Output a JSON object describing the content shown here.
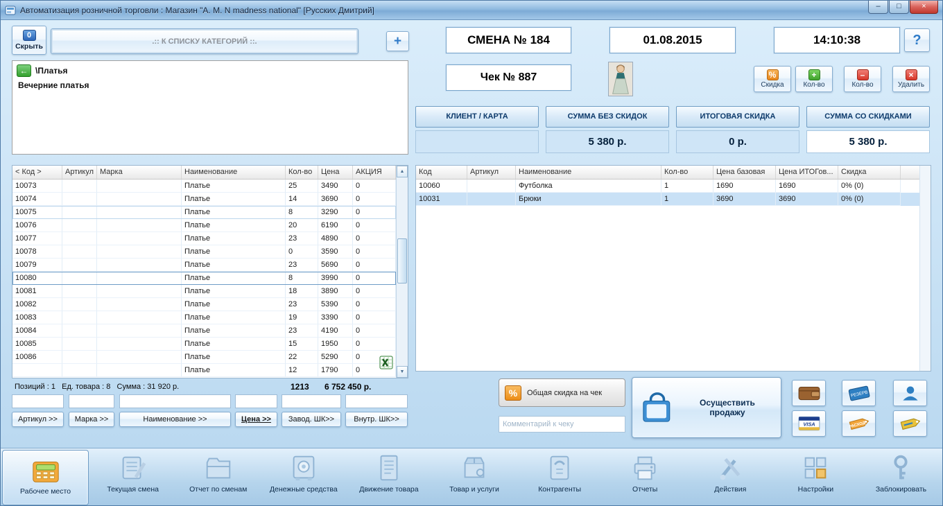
{
  "window": {
    "title": "Автоматизация розничной торговли : Магазин \"A. M. N madness national\" [Русских Дмитрий]",
    "controls": {
      "minimize": "–",
      "maximize": "□",
      "close": "×"
    }
  },
  "glyphs": {
    "plus": "+",
    "question": "?",
    "back": "←",
    "scroll_up": "▲",
    "scroll_down": "▼",
    "percent": "%",
    "qty_plus": "+",
    "qty_minus": "–",
    "delete": "×"
  },
  "top": {
    "hide_button": {
      "badge": "0",
      "label": "Скрыть"
    },
    "categories_button": ".:: К СПИСКУ КАТЕГОРИЙ ::.",
    "shift": "СМЕНА № 184",
    "date": "01.08.2015",
    "time": "14:10:38",
    "receipt": "Чек № 887"
  },
  "item_actions": {
    "discount": "Скидка",
    "qty_up": "Кол-во",
    "qty_down": "Кол-во",
    "delete": "Удалить"
  },
  "summary": {
    "cells": [
      {
        "header": "КЛИЕНТ / КАРТА",
        "value": ""
      },
      {
        "header": "СУММА БЕЗ СКИДОК",
        "value": "5 380 р."
      },
      {
        "header": "ИТОГОВАЯ СКИДКА",
        "value": "0 р."
      },
      {
        "header": "СУММА СО СКИДКАМИ",
        "value": "5 380 р."
      }
    ]
  },
  "catalog": {
    "path": "\\Платья",
    "category": "Вечерние платья",
    "columns": [
      "< Код >",
      "Артикул",
      "Марка",
      "Наименование",
      "Кол-во",
      "Цена",
      "АКЦИЯ"
    ],
    "rows": [
      [
        "10073",
        "",
        "",
        "Платье",
        "25",
        "3490",
        "0"
      ],
      [
        "10074",
        "",
        "",
        "Платье",
        "14",
        "3690",
        "0"
      ],
      [
        "10075",
        "",
        "",
        "Платье",
        "8",
        "3290",
        "0"
      ],
      [
        "10076",
        "",
        "",
        "Платье",
        "20",
        "6190",
        "0"
      ],
      [
        "10077",
        "",
        "",
        "Платье",
        "23",
        "4890",
        "0"
      ],
      [
        "10078",
        "",
        "",
        "Платье",
        "0",
        "3590",
        "0"
      ],
      [
        "10079",
        "",
        "",
        "Платье",
        "23",
        "5690",
        "0"
      ],
      [
        "10080",
        "",
        "",
        "Платье",
        "8",
        "3990",
        "0"
      ],
      [
        "10081",
        "",
        "",
        "Платье",
        "18",
        "3890",
        "0"
      ],
      [
        "10082",
        "",
        "",
        "Платье",
        "23",
        "5390",
        "0"
      ],
      [
        "10083",
        "",
        "",
        "Платье",
        "19",
        "3390",
        "0"
      ],
      [
        "10084",
        "",
        "",
        "Платье",
        "23",
        "4190",
        "0"
      ],
      [
        "10085",
        "",
        "",
        "Платье",
        "15",
        "1950",
        "0"
      ],
      [
        "10086",
        "",
        "",
        "Платье",
        "22",
        "5290",
        "0"
      ],
      [
        "",
        "",
        "",
        "Платье",
        "12",
        "1790",
        "0"
      ]
    ],
    "selected_row": 7,
    "hover_row": 2,
    "status": "Позиций : 1   Ед. товара : 8   Сумма : 31 920 р.",
    "total_qty": "1213",
    "total_sum": "6 752 450 р."
  },
  "filters": {
    "inputs": [
      "",
      "",
      "",
      "",
      "",
      ""
    ],
    "buttons": [
      "Артикул >>",
      "Марка >>",
      "Наименование >>",
      "Цена >>",
      "Завод. ШК>>",
      "Внутр. ШК>>"
    ],
    "active_button": 3
  },
  "receipt_table": {
    "columns": [
      "Код",
      "Артикул",
      "Наименование",
      "Кол-во",
      "Цена базовая",
      "Цена ИТОГов...",
      "Скидка"
    ],
    "rows": [
      [
        "10060",
        "",
        "Футболка",
        "1",
        "1690",
        "1690",
        "0% (0)"
      ],
      [
        "10031",
        "",
        "Брюки",
        "1",
        "3690",
        "3690",
        "0% (0)"
      ]
    ],
    "selected_row": 1
  },
  "sale": {
    "total_discount_button": "Общая скидка на чек",
    "comment_placeholder": "Комментарий к чеку",
    "sell_button": "Осуществить продажу",
    "pay_icons": {
      "reserve": "РЕЗЕРВ",
      "visa": "VISA",
      "expense": "РАСХОД"
    }
  },
  "toolbar": {
    "items": [
      {
        "label": "Рабочее место",
        "icon": "cash-register-icon",
        "active": true
      },
      {
        "label": "Текущая смена",
        "icon": "notepad-icon"
      },
      {
        "label": "Отчет по сменам",
        "icon": "folder-icon"
      },
      {
        "label": "Денежные средства",
        "icon": "safe-icon"
      },
      {
        "label": "Движение товара",
        "icon": "document-icon"
      },
      {
        "label": "Товар и услуги",
        "icon": "box-icon"
      },
      {
        "label": "Контрагенты",
        "icon": "contacts-icon"
      },
      {
        "label": "Отчеты",
        "icon": "printer-icon"
      },
      {
        "label": "Действия",
        "icon": "tools-icon"
      },
      {
        "label": "Настройки",
        "icon": "settings-icon"
      },
      {
        "label": "Заблокировать",
        "icon": "key-icon"
      }
    ]
  }
}
